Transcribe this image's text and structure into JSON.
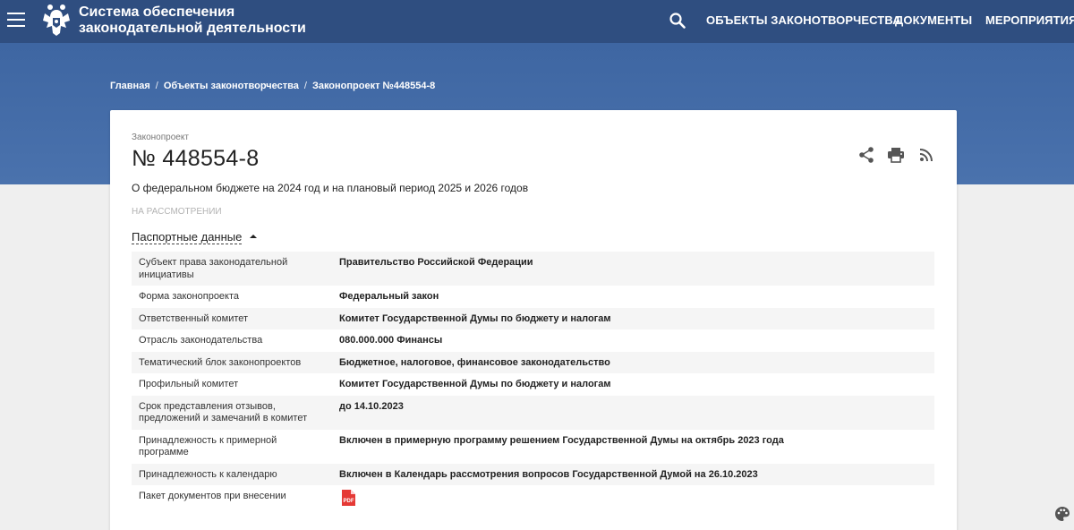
{
  "header": {
    "title_line1": "Система обеспечения",
    "title_line2": "законодательной деятельности",
    "nav": [
      "ОБЪЕКТЫ ЗАКОНОТВОРЧЕСТВА",
      "ДОКУМЕНТЫ",
      "МЕРОПРИЯТИЯ"
    ],
    "icons": {
      "menu": "hamburger-icon",
      "logo": "emblem-icon",
      "search": "search-icon"
    },
    "colors": {
      "topbar": "#2f4e80",
      "band": "#4169a6"
    }
  },
  "breadcrumb": [
    "Главная",
    "Объекты законотворчества",
    "Законопроект №448554-8"
  ],
  "bill": {
    "kind": "Законопроект",
    "number": "№ 448554-8",
    "title": "О федеральном бюджете на 2024 год и на плановый период 2025 и 2026 годов",
    "status": "НА РАССМОТРЕНИИ",
    "tools": [
      "share-icon",
      "print-icon",
      "rss-icon"
    ]
  },
  "passport": {
    "toggle_label": "Паспортные данные",
    "rows": [
      {
        "key": "Субъект права законодательной инициативы",
        "value": "Правительство Российской Федерации"
      },
      {
        "key": "Форма законопроекта",
        "value": "Федеральный закон"
      },
      {
        "key": "Ответственный комитет",
        "value": "Комитет Государственной Думы по бюджету и налогам"
      },
      {
        "key": "Отрасль законодательства",
        "value": "080.000.000 Финансы"
      },
      {
        "key": "Тематический блок законопроектов",
        "value": "Бюджетное, налоговое, финансовое законодательство"
      },
      {
        "key": "Профильный комитет",
        "value": "Комитет Государственной Думы по бюджету и налогам"
      },
      {
        "key": "Срок представления отзывов, предложений и замечаний в комитет",
        "value": "до 14.10.2023"
      },
      {
        "key": "Принадлежность к примерной программе",
        "value": "Включен в примерную программу решением Государственной Думы на октябрь 2023 года"
      },
      {
        "key": "Принадлежность к календарю",
        "value": "Включен в Календарь рассмотрения вопросов Государственной Думой на 26.10.2023"
      },
      {
        "key": "Пакет документов при внесении",
        "value": ""
      }
    ],
    "pdf_label": "PDF"
  }
}
